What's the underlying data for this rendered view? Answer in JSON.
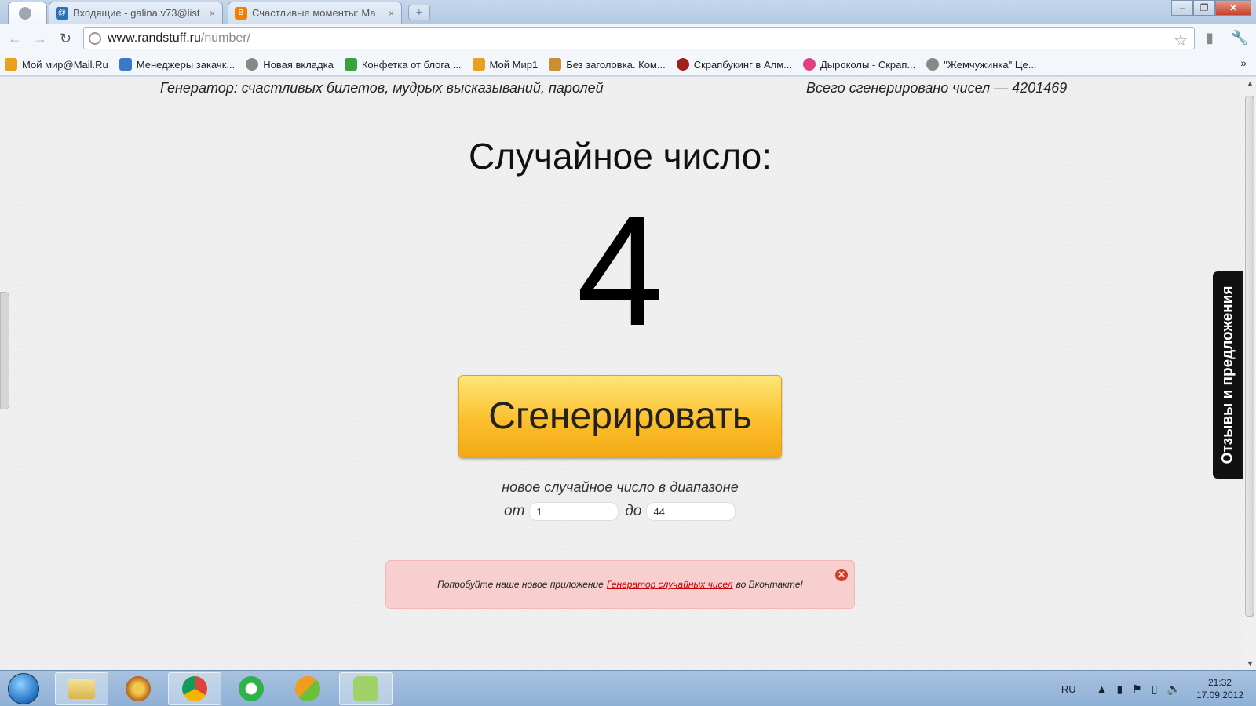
{
  "tabs": [
    {
      "label": "",
      "active": true
    },
    {
      "label": "Входящие - galina.v73@list",
      "close": "×"
    },
    {
      "label": "Счастливые моменты: Ма",
      "close": "×"
    }
  ],
  "address": {
    "host": "www.randstuff.ru",
    "path": "/number/"
  },
  "bookmarks": [
    {
      "label": "Мой мир@Mail.Ru",
      "color": "#e8a020"
    },
    {
      "label": "Менеджеры закачк...",
      "color": "#3a78c8"
    },
    {
      "label": "Новая вкладка",
      "color": "#888888"
    },
    {
      "label": "Конфетка от блога ...",
      "color": "#3aa040"
    },
    {
      "label": "Мой Мир1",
      "color": "#e8a020"
    },
    {
      "label": "Без заголовка. Ком...",
      "color": "#c89030"
    },
    {
      "label": "Скрапбукинг в Алм...",
      "color": "#a02020"
    },
    {
      "label": "Дыроколы - Скрап...",
      "color": "#e04080"
    },
    {
      "label": "\"Жемчужинка\" Це...",
      "color": "#888888"
    }
  ],
  "bookmarks_more": "»",
  "page": {
    "nav_prefix": "Генератор:",
    "nav_links": [
      "счастливых билетов",
      "мудрых высказываний",
      "паролей"
    ],
    "nav_sep": ",",
    "total_label": "Всего сгенерировано чисел — 4201469",
    "heading": "Случайное число:",
    "number": "4",
    "generate_label": "Сгенерировать",
    "range_caption": "новое случайное число в диапазоне",
    "from_label": "от",
    "from_value": "1",
    "to_label": "до",
    "to_value": "44",
    "promo_before": "Попробуйте наше новое приложение",
    "promo_link": "Генератор случайных чисел",
    "promo_after": "во Вконтакте!",
    "feedback_label": "Отзывы и предложения"
  },
  "taskbar": {
    "lang": "RU",
    "time": "21:32",
    "date": "17.09.2012"
  },
  "colors": {
    "button_yellow": "#fbbf2c",
    "promo_bg": "#f8cfcf",
    "promo_link": "#cc0000"
  }
}
